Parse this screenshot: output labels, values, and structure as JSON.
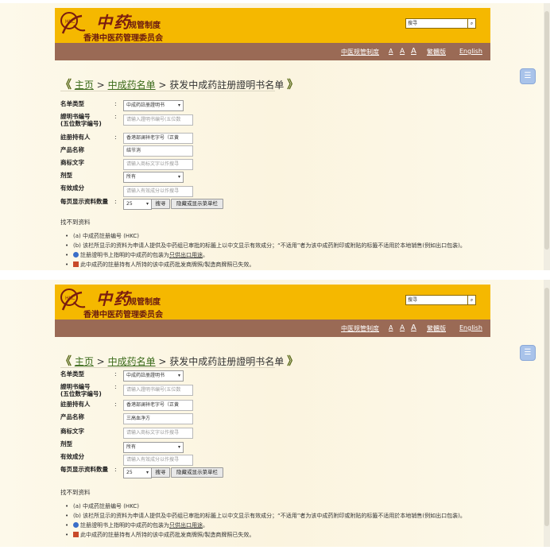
{
  "header": {
    "logo_text": "中药",
    "subtitle": "规管制度",
    "org_name": "香港中医药管理委员会",
    "search_placeholder": "搜寻",
    "search_btn": "🔍"
  },
  "nav": {
    "links": [
      "中医规管制度",
      "A",
      "A",
      "A",
      "繁體版",
      "English"
    ]
  },
  "breadcrumb": {
    "open": "《",
    "home": "主页",
    "sep": ">",
    "list": "中成药名单",
    "current": "获发中成药註册證明书名单",
    "close": "》"
  },
  "form": {
    "labels": {
      "list_type": "名单类型",
      "cert_no": "證明书编号",
      "cert_no_sub": "(五位数字编号)",
      "holder": "註册持有人",
      "product": "产品名称",
      "brand": "商标文字",
      "dosage": "剂型",
      "ingredient": "有效成分",
      "per_page": "每页显示资料数量"
    },
    "colon": ":",
    "list_type_value": "中成药註册證明书",
    "cert_no_placeholder": "请输入證明书编号(五位数",
    "holder_value": "香港部澜祥老字号（正黄",
    "brand_placeholder": "请输入商标文字以作搜寻",
    "dosage_value": "所有",
    "ingredient_placeholder": "请输入有效成分以作搜寻",
    "per_page_value": "25",
    "search_btn": "搜寻",
    "toggle_btn": "隐藏或显示菜单栏"
  },
  "panes": [
    {
      "product_value": "结节消"
    },
    {
      "product_value": "三高血净方"
    }
  ],
  "results": {
    "no_result": "找不到资料"
  },
  "notes": {
    "n1": "(a) 中成药註册编号 (HKC)",
    "n2": "(b) 该栏所显示的资料为申请人提供及中药组已审批的标籤上以中文显示有效成分；“不适用”者为该中成药附印或附贴的标籤不适用於本地销售(例如出口包装)。",
    "n3_pre": "註册證明书上指明的中成药的包装为",
    "n3_link": "只供出口用途",
    "n3_post": "。",
    "n4": "此中成药的註册持有人所持的该中成药批发商牌照/製造商牌照已失效。"
  },
  "arrow": "▾"
}
